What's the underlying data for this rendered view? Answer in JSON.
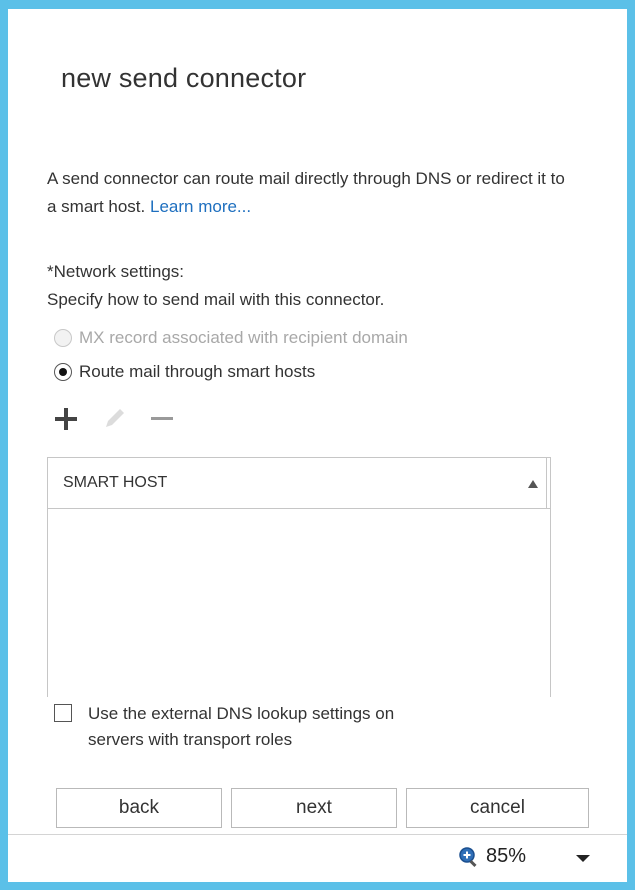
{
  "dialog": {
    "title": "new send connector",
    "intro_text": "A send connector can route mail directly through DNS or redirect it to a smart host.",
    "learn_more": "Learn more..."
  },
  "network": {
    "label": "*Network settings:",
    "description": "Specify how to send mail with this connector.",
    "options": [
      {
        "label": "MX record associated with recipient domain",
        "selected": false,
        "disabled": true
      },
      {
        "label": "Route mail through smart hosts",
        "selected": true,
        "disabled": false
      }
    ]
  },
  "toolbar": {
    "icons": [
      "add-icon",
      "edit-icon",
      "remove-icon"
    ]
  },
  "table": {
    "columns": [
      "SMART HOST"
    ],
    "rows": []
  },
  "external_dns": {
    "label_line1": "Use the external DNS lookup settings on",
    "label_line2": "servers with transport roles",
    "checked": false
  },
  "buttons": {
    "back": "back",
    "next": "next",
    "cancel": "cancel"
  },
  "status": {
    "zoom": "85%",
    "icon": "zoom-icon"
  },
  "colors": {
    "frame": "#5bc0e8",
    "link": "#1e6fbf"
  }
}
